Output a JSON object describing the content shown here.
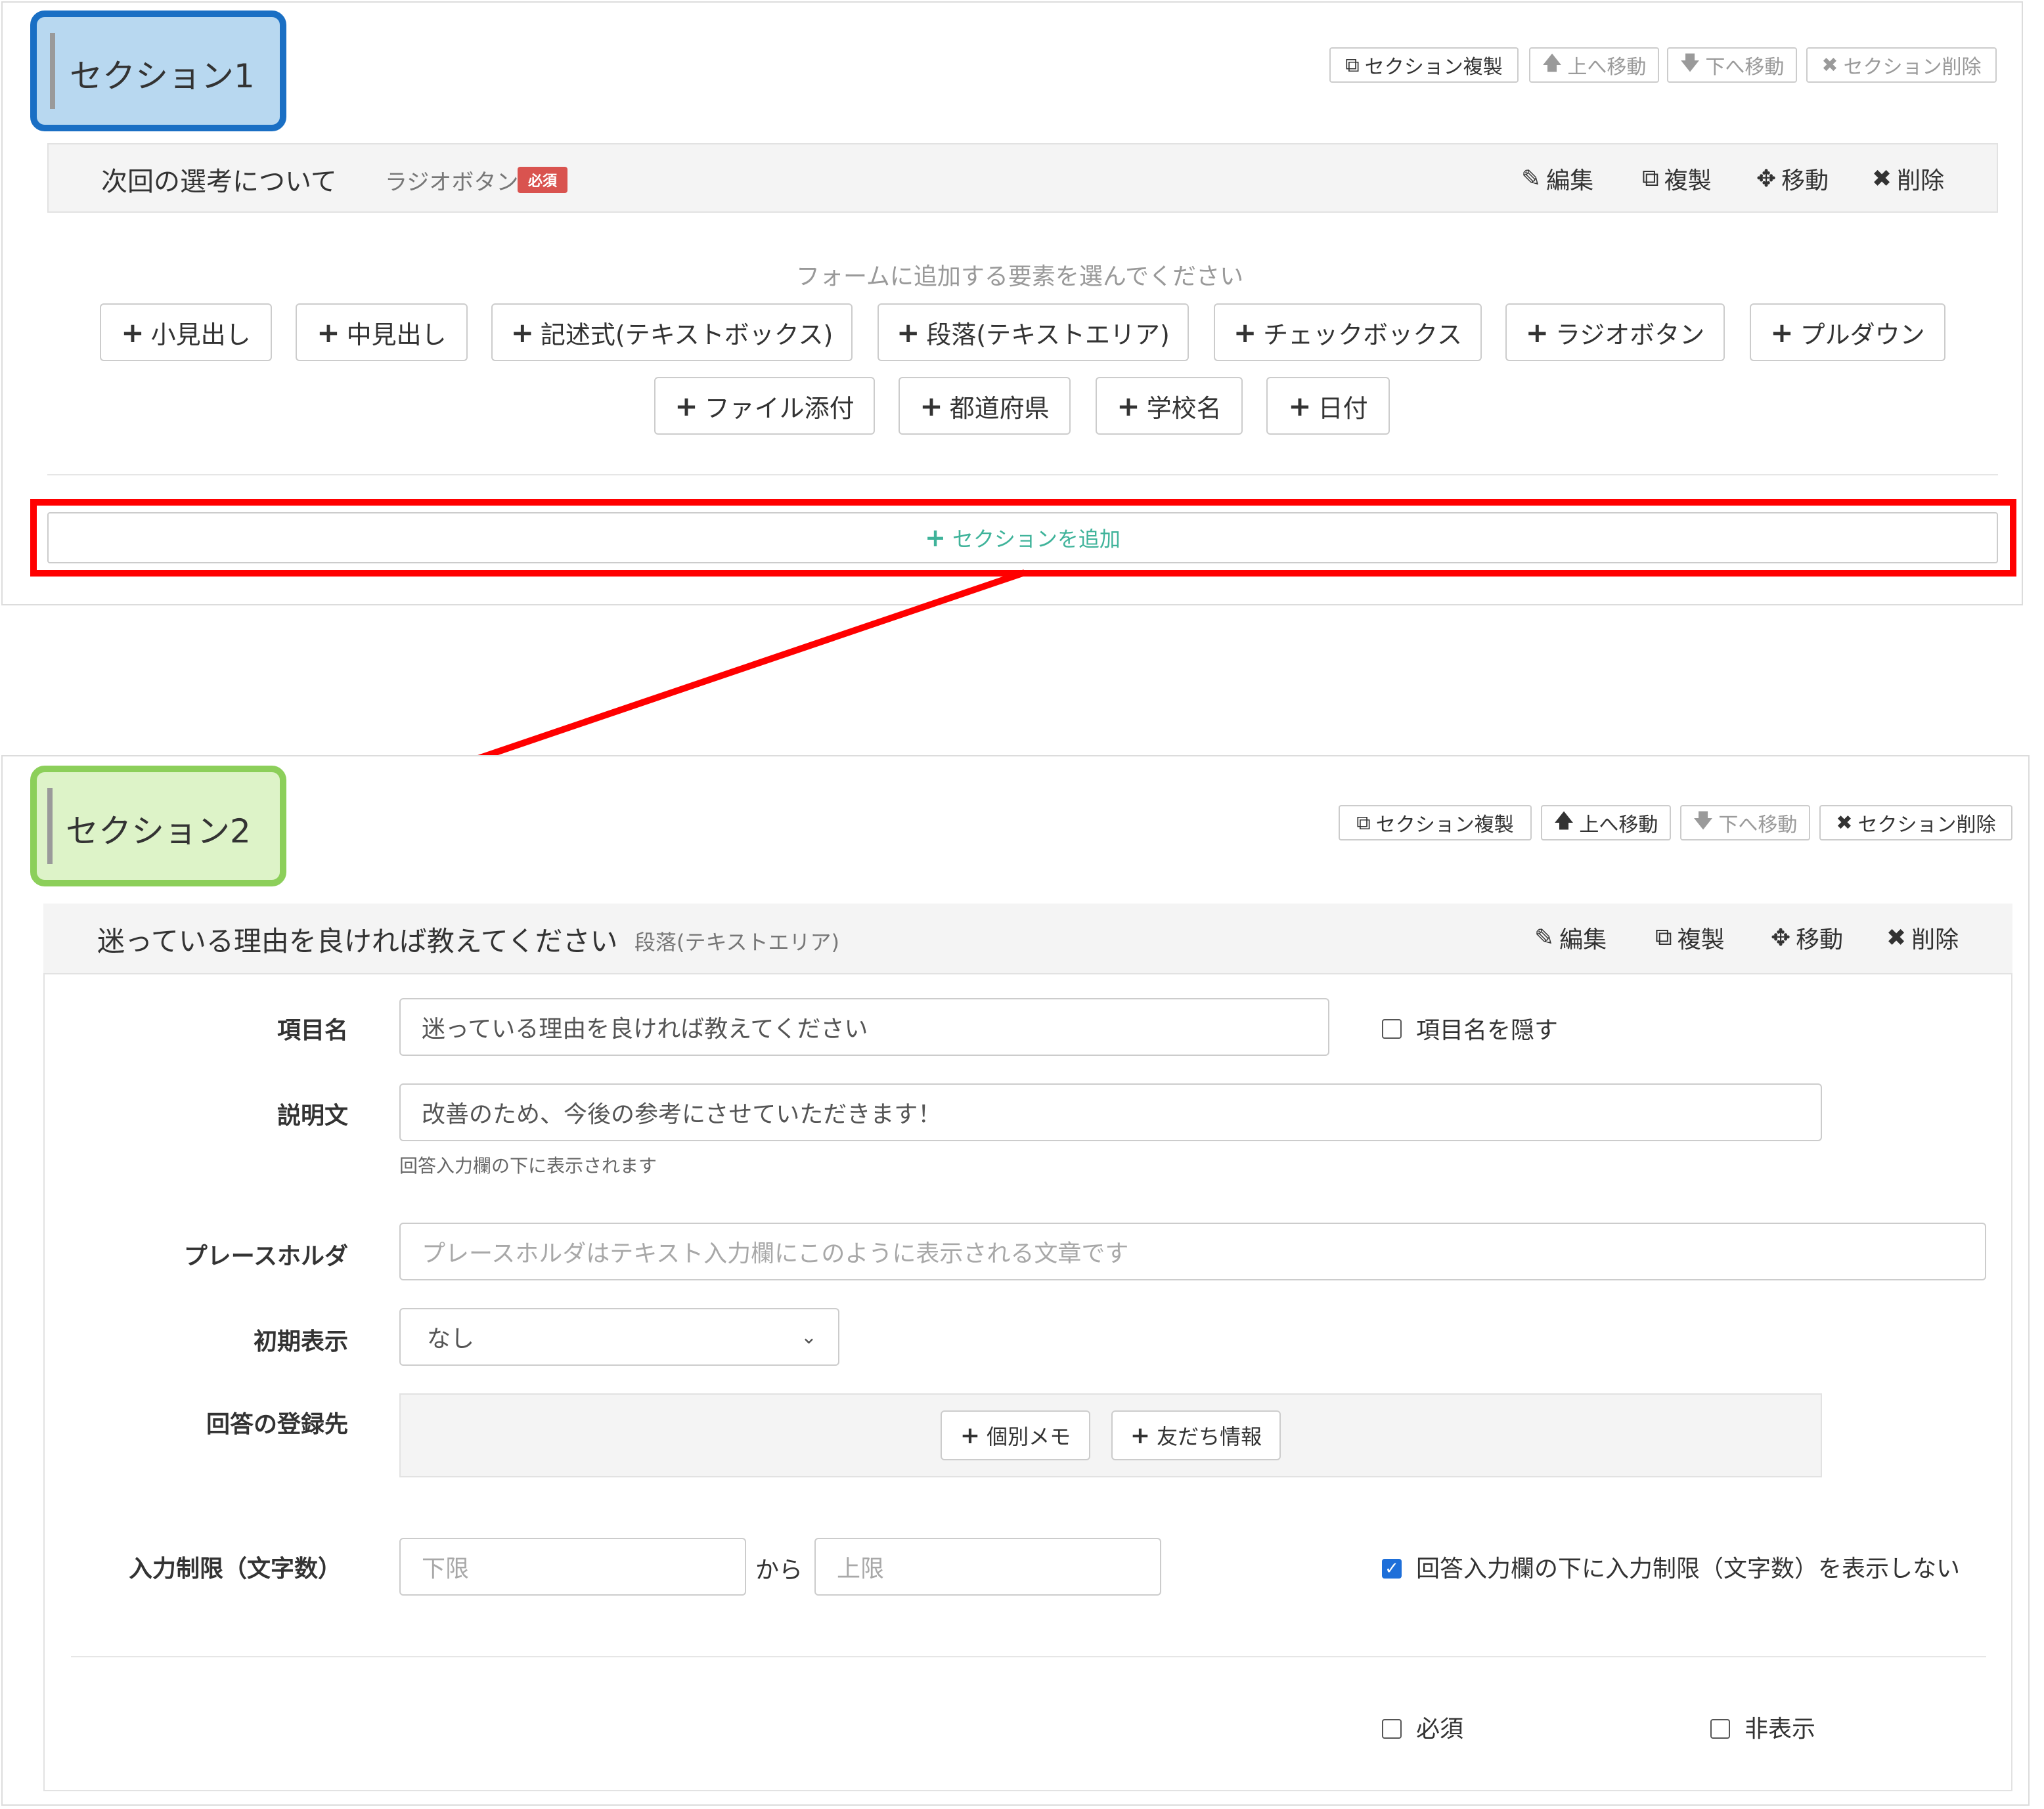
{
  "section1": {
    "title": "セクション1",
    "actions": [
      "セクション複製",
      "上へ移動",
      "下へ移動",
      "セクション削除"
    ],
    "item": {
      "title": "次回の選考について",
      "type": "ラジオボタン",
      "badge": "必須"
    },
    "item_actions": [
      "編集",
      "複製",
      "移動",
      "削除"
    ],
    "add_hint": "フォームに追加する要素を選んでください",
    "add_buttons_row1": [
      "小見出し",
      "中見出し",
      "記述式(テキストボックス)",
      "段落(テキストエリア)",
      "チェックボックス",
      "ラジオボタン",
      "プルダウン"
    ],
    "add_buttons_row2": [
      "ファイル添付",
      "都道府県",
      "学校名",
      "日付"
    ],
    "add_section": "セクションを追加"
  },
  "section2": {
    "title": "セクション2",
    "actions": [
      "セクション複製",
      "上へ移動",
      "下へ移動",
      "セクション削除"
    ],
    "item": {
      "title": "迷っている理由を良ければ教えてください",
      "type": "段落(テキストエリア)"
    },
    "item_actions": [
      "編集",
      "複製",
      "移動",
      "削除"
    ],
    "form": {
      "name_label": "項目名",
      "name_value": "迷っている理由を良ければ教えてください",
      "hide_name": "項目名を隠す",
      "desc_label": "説明文",
      "desc_value": "改善のため、今後の参考にさせていただきます！",
      "desc_help": "回答入力欄の下に表示されます",
      "placeholder_label": "プレースホルダ",
      "placeholder_hint": "プレースホルダはテキスト入力欄にこのように表示される文章です",
      "initial_label": "初期表示",
      "initial_value": "なし",
      "dest_label": "回答の登録先",
      "dest_buttons": [
        "個別メモ",
        "友だち情報"
      ],
      "limit_label": "入力制限（文字数）",
      "limit_min": "下限",
      "limit_sep": "から",
      "limit_max": "上限",
      "limit_hide": "回答入力欄の下に入力制限（文字数）を表示しない",
      "required": "必須",
      "hidden": "非表示"
    }
  },
  "colors": {
    "section1_badge_bg": "#b8d8f0",
    "section1_badge_border": "#1a6fc4",
    "section2_badge_bg": "#ddf3c8",
    "section2_badge_border": "#8ccf5a",
    "highlight": "#ff0000",
    "required_badge": "#d9534f",
    "add_section_text": "#3fb39a",
    "checkbox_checked": "#1e6fd9"
  }
}
